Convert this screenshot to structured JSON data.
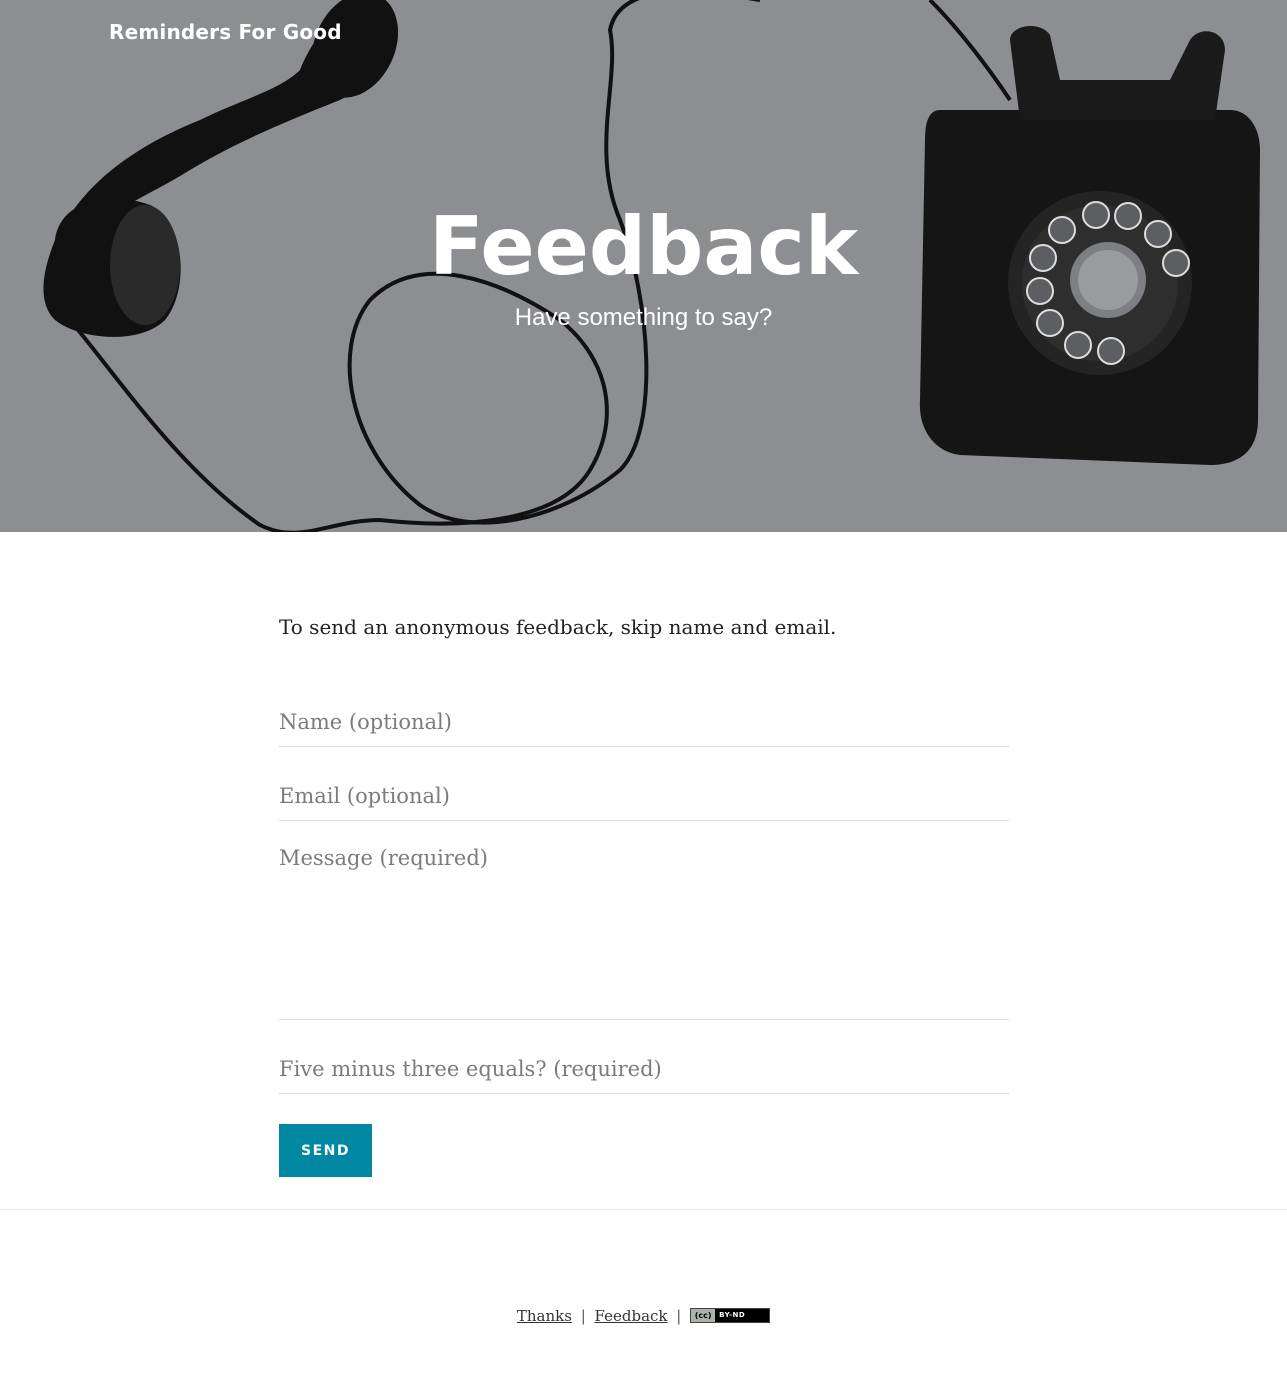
{
  "header": {
    "brand": "Reminders For Good",
    "title": "Feedback",
    "subtitle": "Have something to say?"
  },
  "form": {
    "intro": "To send an anonymous feedback, skip name and email.",
    "name_placeholder": "Name (optional)",
    "email_placeholder": "Email (optional)",
    "message_placeholder": "Message (required)",
    "captcha_placeholder": "Five minus three equals? (required)",
    "send_label": "SEND"
  },
  "footer": {
    "thanks_link": "Thanks",
    "separator": "|",
    "feedback_link": "Feedback",
    "license_left": "(cc)",
    "license_right": "BY-ND"
  },
  "colors": {
    "accent": "#0087a2",
    "hero_overlay": "#8e8f93"
  }
}
